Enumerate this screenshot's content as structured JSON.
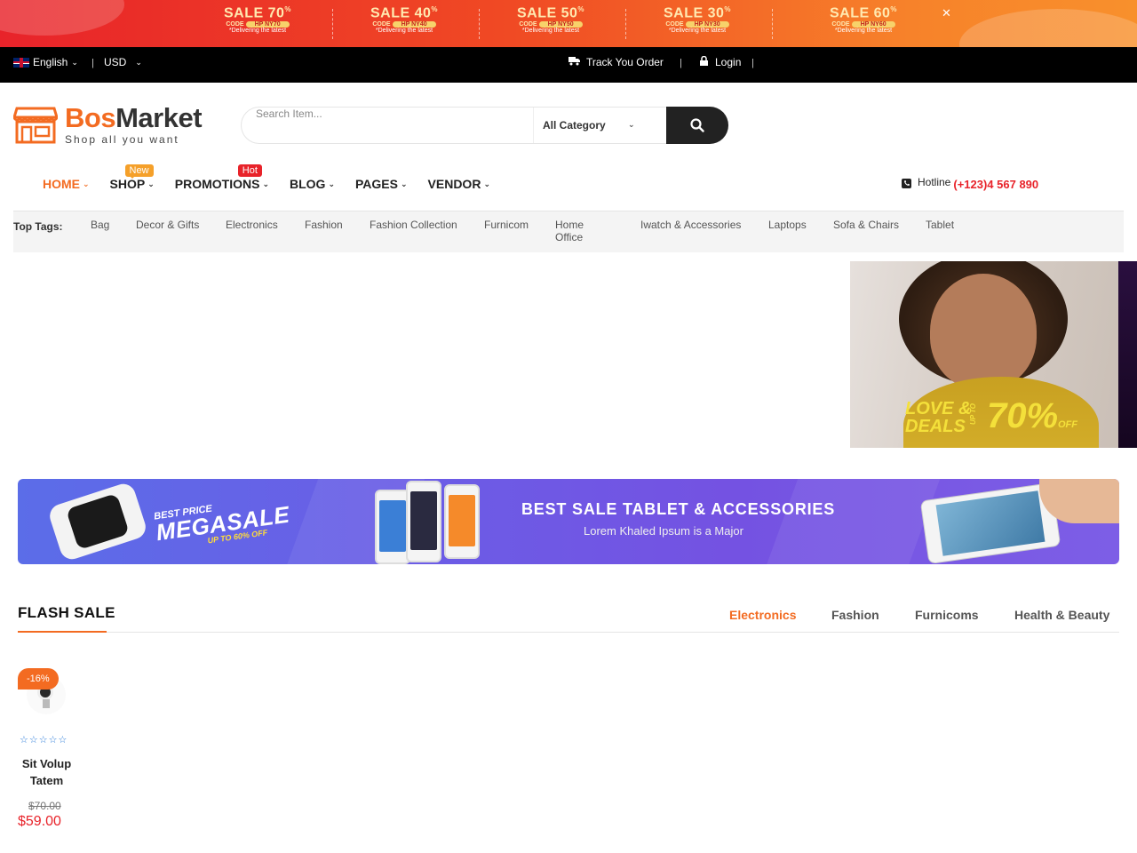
{
  "promo_banner": {
    "offers": [
      {
        "title": "SALE 70",
        "code_label": "CODE",
        "code": "HP NY70",
        "note": "*Delivering the latest"
      },
      {
        "title": "SALE 40",
        "code_label": "CODE",
        "code": "HP NY40",
        "note": "*Delivering the latest"
      },
      {
        "title": "SALE 50",
        "code_label": "CODE",
        "code": "HP NY50",
        "note": "*Delivering the latest"
      },
      {
        "title": "SALE 30",
        "code_label": "CODE",
        "code": "HP NY30",
        "note": "*Delivering the latest"
      },
      {
        "title": "SALE 60",
        "code_label": "CODE",
        "code": "HP NY60",
        "note": "*Delivering the latest"
      }
    ],
    "percent_sign": "%",
    "close": "✕"
  },
  "topbar": {
    "language": "English",
    "currency": "USD",
    "track_order": "Track You Order",
    "login": "Login",
    "sep": "|"
  },
  "logo": {
    "brand_a": "Bos",
    "brand_b": "Market",
    "tagline": "Shop all you want"
  },
  "search": {
    "placeholder": "Search Item...",
    "category": "All Category"
  },
  "nav": {
    "items": [
      {
        "label": "HOME"
      },
      {
        "label": "SHOP",
        "badge": "New"
      },
      {
        "label": "PROMOTIONS",
        "badge": "Hot"
      },
      {
        "label": "BLOG"
      },
      {
        "label": "PAGES"
      },
      {
        "label": "VENDOR"
      }
    ]
  },
  "hotline": {
    "label": "Hotline",
    "number": "(+123)4 567 890"
  },
  "tags": {
    "label": "Top Tags:",
    "items": [
      "Bag",
      "Decor & Gifts",
      "Electronics",
      "Fashion",
      "Fashion Collection",
      "Furnicom",
      "Home Office",
      "Iwatch & Accessories",
      "Laptops",
      "Sofa & Chairs",
      "Tablet"
    ]
  },
  "hero": {
    "line1": "LOVE &",
    "line2": "DEALS",
    "upto": "UP TO",
    "percent": "70%",
    "off": "OFF"
  },
  "wide_banner": {
    "best_price": "BEST PRICE",
    "megasale": "MEGASALE",
    "upto": "UP TO 60% OFF",
    "heading": "BEST SALE TABLET &  ACCESSORIES",
    "subheading": "Lorem Khaled Ipsum is a Major"
  },
  "flash_sale": {
    "title": "FLASH SALE",
    "tabs": [
      "Electronics",
      "Fashion",
      "Furnicoms",
      "Health & Beauty"
    ],
    "products": [
      {
        "discount": "-16%",
        "name": "Sit Volup Tatem",
        "old_price": "$70.00",
        "price": "$59.00",
        "rating": 0,
        "stars": "☆☆☆☆☆"
      }
    ]
  },
  "colors": {
    "accent": "#f36b21",
    "hot": "#e8232a",
    "new": "#f5a02a",
    "rating": "#2a7ad8"
  }
}
